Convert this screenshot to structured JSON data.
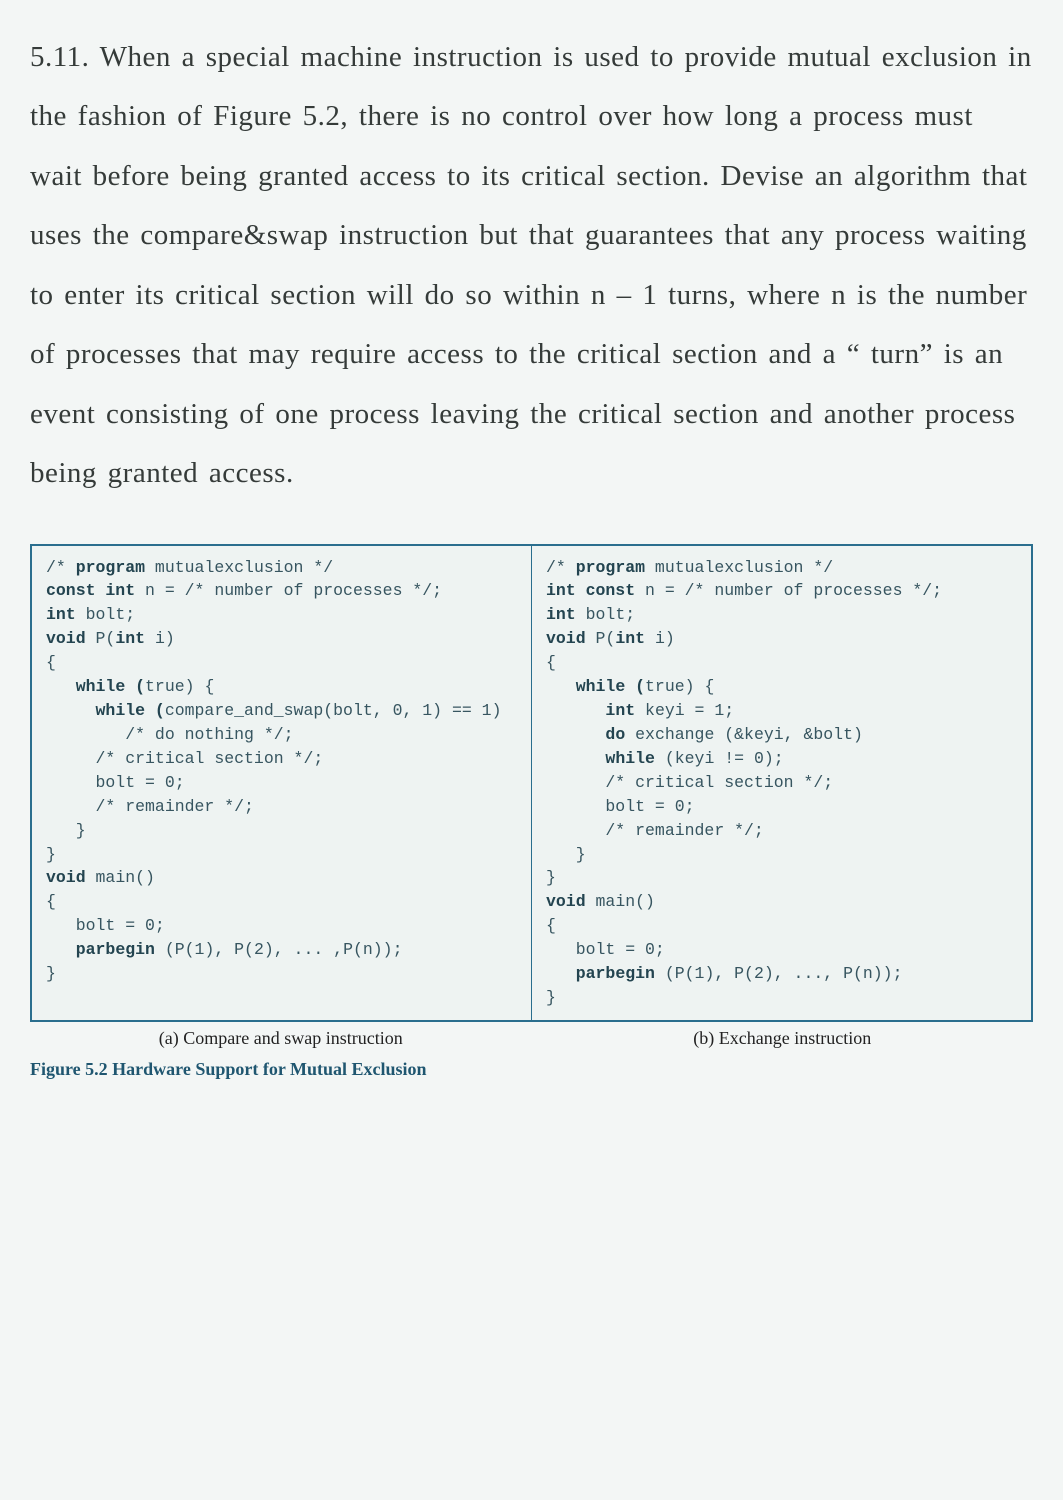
{
  "question": "5.11. When a special machine instruction is used to provide mutual exclusion in the fashion of Figure 5.2, there is no control over how long a process must wait before being  granted access to its critical section. Devise an algorithm that uses the compare&swap  instruction but that guarantees that any process waiting to enter its critical section will  do so within n  – 1 turns, where n is the number of processes that may require access to  the critical section and a  “ turn”  is an event consisting of one process leaving the critical  section and another process being granted access.",
  "code_left": {
    "l1a": "/* ",
    "l1b": "program",
    "l1c": " mutualexclusion */",
    "l2a": "const int",
    "l2b": " n = /* number of processes */;",
    "l3a": "int",
    "l3b": " bolt;",
    "l4a": "void",
    "l4b": " P(",
    "l4c": "int",
    "l4d": " i)",
    "l5": "{",
    "l6a": "   ",
    "l6b": "while (",
    "l6c": "true) {",
    "l7a": "     ",
    "l7b": "while (",
    "l7c": "compare_and_swap(bolt, 0, 1) == 1)",
    "l8": "        /* do nothing */;",
    "l9": "     /* critical section */;",
    "l10": "     bolt = 0;",
    "l11": "     /* remainder */;",
    "l12": "   }",
    "l13": "}",
    "l14a": "void",
    "l14b": " main()",
    "l15": "{",
    "l16": "   bolt = 0;",
    "l17a": "   ",
    "l17b": "parbegin",
    "l17c": " (P(1), P(2), ... ,P(n));",
    "l18": "}"
  },
  "code_right": {
    "r1a": "/* ",
    "r1b": "program",
    "r1c": " mutualexclusion */",
    "r2a": "int const",
    "r2b": " n = /* number of processes */;",
    "r3a": "int",
    "r3b": " bolt;",
    "r4a": "void",
    "r4b": " P(",
    "r4c": "int",
    "r4d": " i)",
    "r5": "{",
    "r6a": "   ",
    "r6b": "while (",
    "r6c": "true) {",
    "r7a": "      ",
    "r7b": "int",
    "r7c": " keyi = 1;",
    "r8a": "      ",
    "r8b": "do",
    "r8c": " exchange (&keyi, &bolt)",
    "r9a": "      ",
    "r9b": "while",
    "r9c": " (keyi != 0);",
    "r10": "      /* critical section */;",
    "r11": "      bolt = 0;",
    "r12": "      /* remainder */;",
    "r13": "   }",
    "r14": "}",
    "r15a": "void",
    "r15b": " main()",
    "r16": "{",
    "r17": "   bolt = 0;",
    "r18a": "   ",
    "r18b": "parbegin",
    "r18c": " (P(1), P(2), ..., P(n));",
    "r19": "}"
  },
  "caption_a": "(a) Compare and swap instruction",
  "caption_b": "(b) Exchange instruction",
  "figure_title": "Figure 5.2   Hardware Support for Mutual Exclusion"
}
